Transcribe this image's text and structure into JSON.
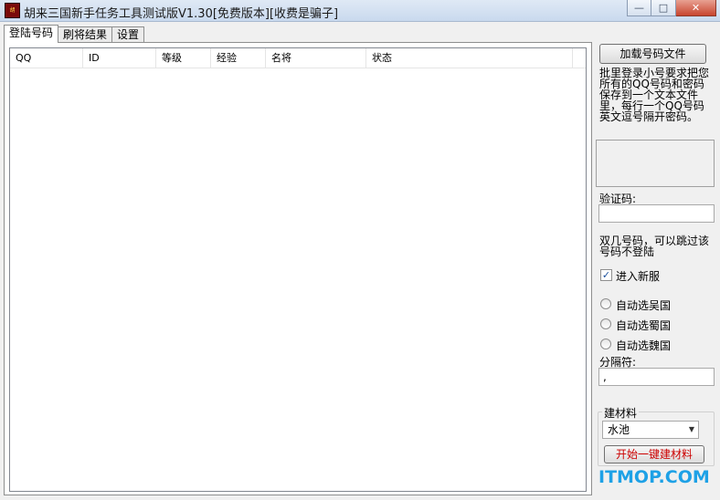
{
  "window": {
    "title": "胡来三国新手任务工具测试版V1.30[免费版本][收费是骗子]",
    "icon": "app-logo-icon",
    "minimize_glyph": "—",
    "maximize_glyph": "□",
    "close_glyph": "✕"
  },
  "tabs": [
    {
      "label": "登陆号码"
    },
    {
      "label": "刷将结果"
    },
    {
      "label": "设置"
    }
  ],
  "table": {
    "columns": [
      "QQ",
      "ID",
      "等级",
      "经验",
      "名将",
      "状态"
    ],
    "rows": []
  },
  "panel": {
    "load_button": "加载号码文件",
    "instructions": "批里登录小号要求把您所有的QQ号码和密码保存到一个文本文件里，每行一个QQ号码英文逗号隔开密码。",
    "captcha_label": "验证码:",
    "captcha_value": "",
    "skip_hint": "双几号码，可以跳过该号码不登陆",
    "enter_new_server_label": "进入新服",
    "enter_new_server_checked": true,
    "faction_options": [
      "自动选吴国",
      "自动选蜀国",
      "自动选魏国"
    ],
    "separator_label": "分隔符:",
    "separator_value": ",",
    "material_group_label": "建材料",
    "material_selected": "水池",
    "start_button": "开始一键建材料"
  },
  "watermark": "ITMOP.COM",
  "colors": {
    "start_button_text": "#cc0000",
    "watermark": "#1ea1e6"
  }
}
